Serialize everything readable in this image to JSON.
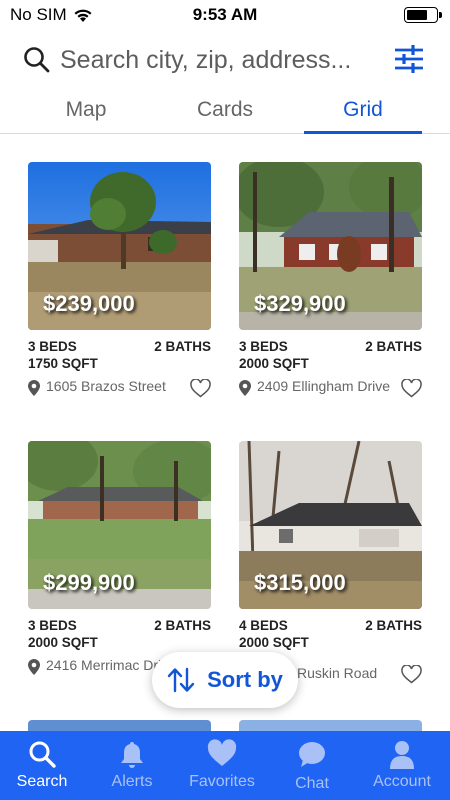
{
  "status": {
    "carrier": "No SIM",
    "time": "9:53 AM"
  },
  "search": {
    "placeholder": "Search city, zip, address..."
  },
  "tabs": [
    {
      "label": "Map"
    },
    {
      "label": "Cards"
    },
    {
      "label": "Grid",
      "active": true
    }
  ],
  "listings": [
    {
      "price": "$239,000",
      "beds": "3 BEDS",
      "baths": "2 BATHS",
      "sqft": "1750 SQFT",
      "address": "1605 Brazos Street"
    },
    {
      "price": "$329,900",
      "beds": "3 BEDS",
      "baths": "2 BATHS",
      "sqft": "2000 SQFT",
      "address": "2409 Ellingham Drive"
    },
    {
      "price": "$299,900",
      "beds": "3 BEDS",
      "baths": "2 BATHS",
      "sqft": "2000 SQFT",
      "address": "2416 Merrimac Drive"
    },
    {
      "price": "$315,000",
      "beds": "4 BEDS",
      "baths": "2 BATHS",
      "sqft": "2000 SQFT",
      "address": "Ruskin Road"
    }
  ],
  "sort": {
    "label": "Sort by"
  },
  "tab_bar": [
    {
      "label": "Search",
      "icon": "search-icon",
      "active": true
    },
    {
      "label": "Alerts",
      "icon": "bell-icon"
    },
    {
      "label": "Favorites",
      "icon": "heart-icon"
    },
    {
      "label": "Chat",
      "icon": "chat-bubble-icon"
    },
    {
      "label": "Account",
      "icon": "person-icon"
    }
  ],
  "colors": {
    "accent": "#1256d8",
    "tab_bar": "#1f64f2",
    "tab_bar_inactive": "#a9c1f6"
  }
}
